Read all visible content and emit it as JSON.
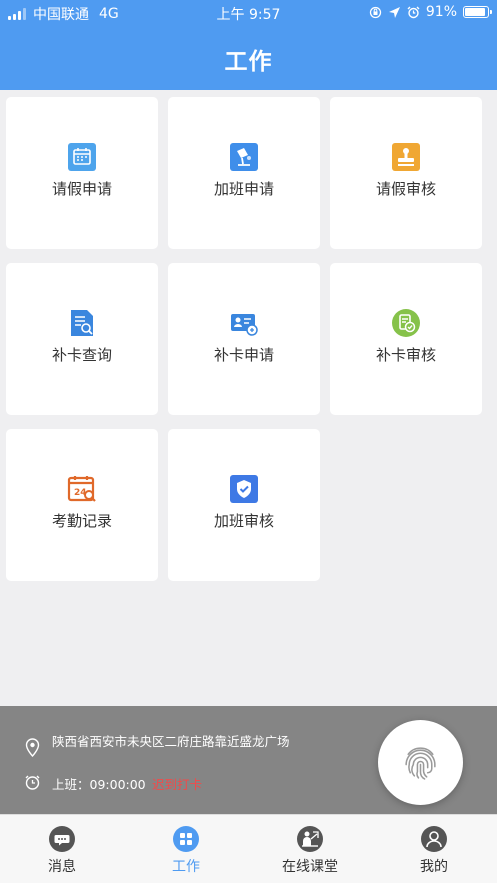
{
  "status_bar": {
    "carrier": "中国联通",
    "network": "4G",
    "time": "上午 9:57",
    "battery": "91%",
    "battery_level": 0.91
  },
  "header": {
    "title": "工作"
  },
  "tiles": [
    {
      "label": "请假申请",
      "icon": "calendar-icon",
      "color": "#4ea4ec"
    },
    {
      "label": "加班申请",
      "icon": "desk-lamp-icon",
      "color": "#3f8eea"
    },
    {
      "label": "请假审核",
      "icon": "stamp-icon",
      "color": "#f0a733"
    },
    {
      "label": "补卡查询",
      "icon": "document-search-icon",
      "color": "#3a86de"
    },
    {
      "label": "补卡申请",
      "icon": "id-card-icon",
      "color": "#3a86de"
    },
    {
      "label": "补卡审核",
      "icon": "approve-check-icon",
      "color": "#86c24a"
    },
    {
      "label": "考勤记录",
      "icon": "attendance-calendar-icon",
      "color": "#e0692a"
    },
    {
      "label": "加班审核",
      "icon": "shield-check-icon",
      "color": "#3e79e5"
    }
  ],
  "checkin": {
    "address": "陕西省西安市未央区二府庄路靠近盛龙广场",
    "shift": "上班：09:00:00",
    "late_status": "迟到打卡",
    "late_color": "#f04b4b",
    "fingerprint_icon": "fingerprint-icon"
  },
  "tabbar": {
    "active_color": "#4f9bf1",
    "items": [
      {
        "label": "消息",
        "icon": "chat-bubble-icon",
        "active": false
      },
      {
        "label": "工作",
        "icon": "grid-icon",
        "active": true
      },
      {
        "label": "在线课堂",
        "icon": "teacher-icon",
        "active": false
      },
      {
        "label": "我的",
        "icon": "user-icon",
        "active": false
      }
    ]
  }
}
